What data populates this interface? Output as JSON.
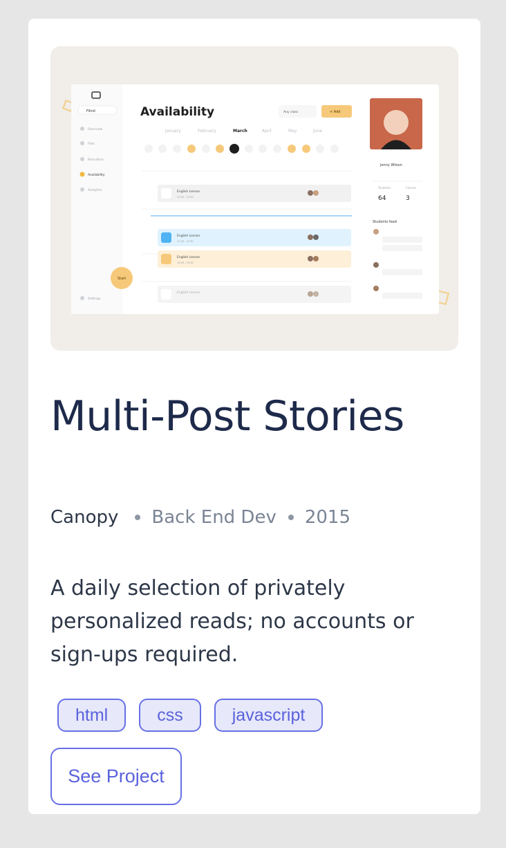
{
  "project": {
    "title": "Multi-Post Stories",
    "company": "Canopy",
    "role": "Back End Dev",
    "year": "2015",
    "description": "A daily selection of privately personalized reads; no accounts or sign-ups required.",
    "tags": [
      "html",
      "css",
      "javascript"
    ],
    "button_label": "See Project"
  },
  "screenshot": {
    "brand": "Filinit",
    "heading": "Availability",
    "months": [
      "January",
      "February",
      "March",
      "April",
      "May",
      "June"
    ],
    "active_month": "March",
    "sidebar_items": [
      "Overview",
      "Files",
      "Recruiters",
      "Availability",
      "Analytics"
    ],
    "start_label": "Start",
    "settings_label": "Settings",
    "filter_label": "Any class",
    "add_label": "+ Add",
    "lessons": [
      {
        "label": "English Lesson",
        "time": "12:00 - 13:00",
        "status": "gray"
      },
      {
        "label": "English Lesson",
        "time": "11:30 - 12:30",
        "status": "blue"
      },
      {
        "label": "English Lesson",
        "time": "12:30 - 13:30",
        "status": "orange"
      },
      {
        "label": "English Lesson",
        "time": "",
        "status": "gray"
      }
    ],
    "profile_name": "Jenny Wilson",
    "stats": [
      {
        "label": "Students",
        "value": "64"
      },
      {
        "label": "Classes",
        "value": "3"
      }
    ],
    "feed_title": "Students feed",
    "colors": {
      "accent": "#f6c97a",
      "blue": "#dff2fe",
      "dark": "#1e2a4a",
      "link": "#5a62dd"
    }
  }
}
